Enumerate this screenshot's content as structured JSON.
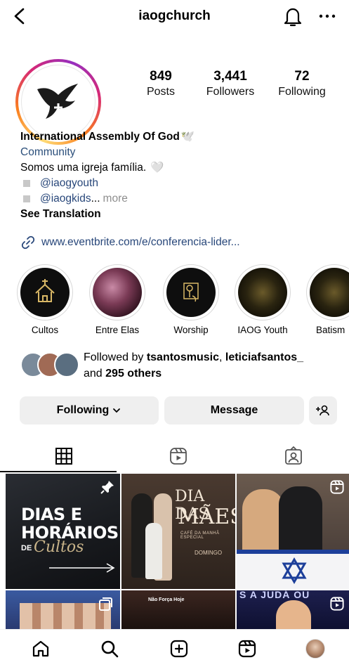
{
  "header": {
    "username": "iaogchurch"
  },
  "stats": [
    {
      "value": "849",
      "label": "Posts"
    },
    {
      "value": "3,441",
      "label": "Followers"
    },
    {
      "value": "72",
      "label": "Following"
    }
  ],
  "bio": {
    "name": "International Assembly Of God",
    "name_emoji": "🕊️",
    "category": "Community",
    "line": "Somos uma igreja família.",
    "line_emoji": "🤍",
    "handle_1": "@iaogyouth",
    "handle_2": "@iaogkids",
    "handle_2_suffix": "...",
    "more": "more",
    "see_translation": "See Translation",
    "link": "www.eventbrite.com/e/conferencia-lider..."
  },
  "highlights": [
    {
      "label": "Cultos"
    },
    {
      "label": "Entre Elas"
    },
    {
      "label": "Worship"
    },
    {
      "label": "IAOG Youth"
    },
    {
      "label": "Batism"
    }
  ],
  "followed_by": {
    "prefix": "Followed by",
    "user_1": "tsantosmusic",
    "separator": ",",
    "user_2": "leticiafsantos_",
    "and": "and",
    "others": "295 others"
  },
  "buttons": {
    "following": "Following",
    "message": "Message"
  },
  "posts": [
    {
      "line1": "DIAS E",
      "line2": "HORÁRIOS",
      "line3": "DE",
      "script": "Cultos",
      "pinned": true
    },
    {
      "title1": "DIA DAS",
      "title2": "MÃES",
      "sub": "CAFÉ DA MANHÃ ESPECIAL",
      "day": "DOMINGO"
    },
    {
      "reel": true
    },
    {
      "reel": false
    },
    {
      "caption": "Não Força Hoje"
    },
    {
      "top_text": "S A JUDÁ OU",
      "reel": true
    }
  ],
  "colors": {
    "accent_link": "#28477a",
    "button_bg": "#efefef",
    "ring_gradient": [
      "#feda75",
      "#fa7e1e",
      "#d62976",
      "#962fbf"
    ]
  }
}
